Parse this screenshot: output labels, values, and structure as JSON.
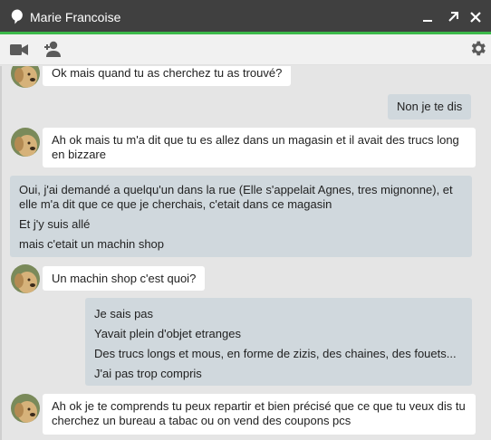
{
  "window": {
    "title": "Marie Francoise",
    "accent_color": "#3cb94a",
    "titlebar_color": "#404040"
  },
  "titlebar_icons": [
    "chat-bubble-icon",
    "minimize-icon",
    "popout-icon",
    "close-icon"
  ],
  "toolbar_icons": [
    "video-call-icon",
    "add-person-icon",
    "gear-icon"
  ],
  "messages": [
    {
      "direction": "in",
      "lines": [
        "Ok mais quand tu as cherchez tu as trouvé?"
      ]
    },
    {
      "direction": "out",
      "lines": [
        "Non je te dis"
      ]
    },
    {
      "direction": "in",
      "lines": [
        "Ah ok mais tu m'a dit que tu es allez dans un magasin et il avait des trucs long",
        "en bizzare"
      ]
    },
    {
      "direction": "out",
      "lines": [
        "Oui, j'ai demandé a quelqu'un dans la rue (Elle s'appelait Agnes, tres mignonne), et",
        "elle m'a dit que ce que je cherchais, c'etait dans ce magasin",
        "Et j'y suis allé",
        "mais c'etait un machin shop"
      ]
    },
    {
      "direction": "in",
      "lines": [
        "Un machin shop c'est quoi?"
      ]
    },
    {
      "direction": "out",
      "lines": [
        "Je sais pas",
        "Yavait plein d'objet  etranges",
        "Des trucs longs et mous, en forme de zizis, des chaines, des fouets...",
        "J'ai pas trop compris"
      ]
    },
    {
      "direction": "in",
      "lines": [
        "Ah ok je te comprends tu peux repartir et bien précisé que ce que tu veux dis tu",
        "cherchez un bureau a tabac ou on vend des coupons pcs"
      ]
    }
  ],
  "colors": {
    "incoming_bubble": "#ffffff",
    "outgoing_bubble": "#d0d8dd",
    "background": "#e5e5e5"
  }
}
